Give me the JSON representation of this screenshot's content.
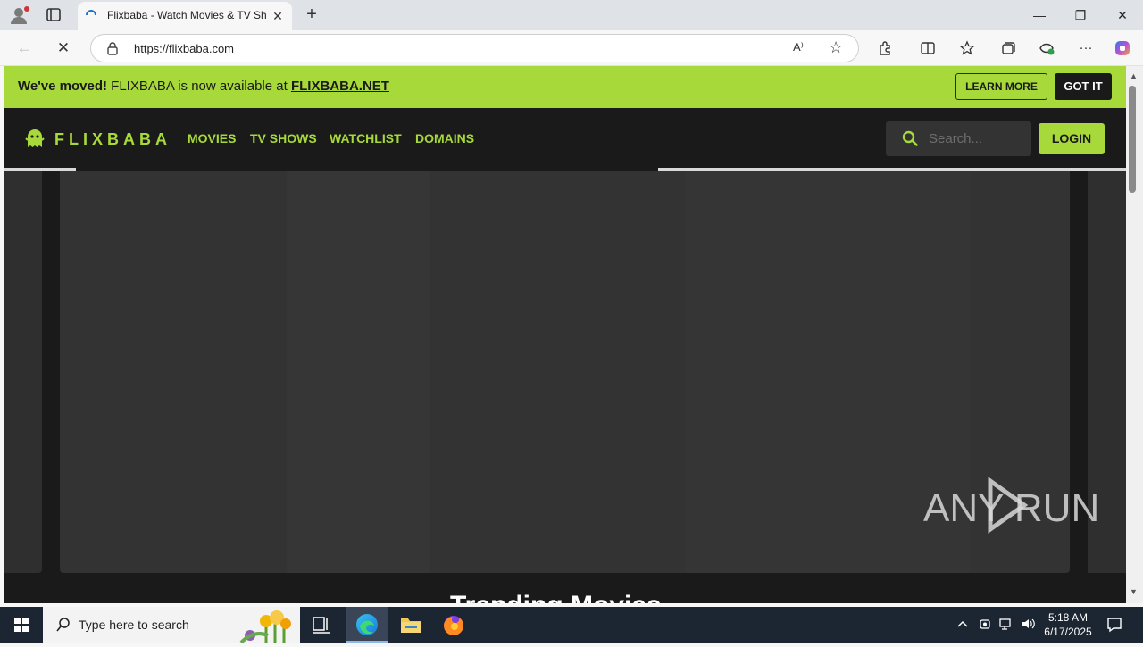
{
  "browser": {
    "tab_title": "Flixbaba - Watch Movies & TV Shows",
    "tab_close": "✕",
    "new_tab": "+",
    "url": "https://flixbaba.com",
    "read_aloud": "A⁾",
    "window_controls": {
      "minimize": "—",
      "maximize": "❐",
      "close": "✕"
    },
    "nav": {
      "back": "←",
      "stop": "✕"
    }
  },
  "banner": {
    "bold_text": "We've moved!",
    "text": " FLIXBABA is now available at ",
    "link": "FLIXBABA.NET",
    "learn_more": "LEARN MORE",
    "got_it": "GOT IT"
  },
  "header": {
    "logo": "FLIXBABA",
    "nav": [
      "MOVIES",
      "TV SHOWS",
      "WATCHLIST",
      "DOMAINS"
    ],
    "search_placeholder": "Search...",
    "login": "LOGIN"
  },
  "section": {
    "title": "Trending Movies"
  },
  "watermark": "ANY RUN",
  "taskbar": {
    "search_placeholder": "Type here to search",
    "time": "5:18 AM",
    "date": "6/17/2025"
  },
  "colors": {
    "accent": "#a7d93a",
    "page_bg": "#1a1a1a",
    "taskbar": "#1c2532"
  }
}
